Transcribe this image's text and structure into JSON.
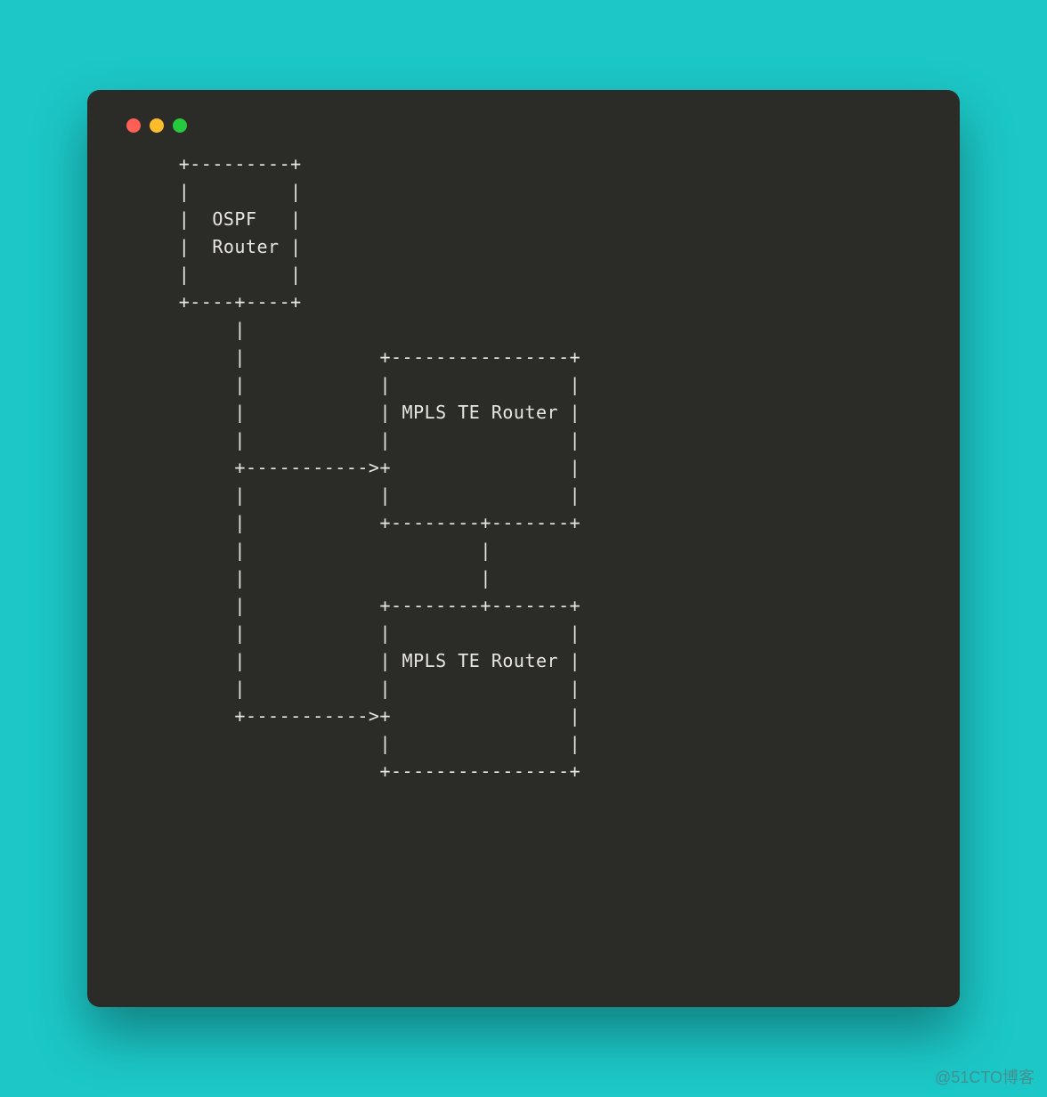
{
  "window": {
    "title_icons": [
      "close",
      "minimize",
      "maximize"
    ]
  },
  "diagram": {
    "lines": [
      "     +---------+",
      "     |         |",
      "     |  OSPF   |",
      "     |  Router |",
      "     |         |",
      "     +----+----+",
      "          |",
      "          |            +----------------+",
      "          |            |                |",
      "          |            | MPLS TE Router |",
      "          |            |                |",
      "          +----------->+                |",
      "          |            |                |",
      "          |            +--------+-------+",
      "          |                     |",
      "          |                     |",
      "          |            +--------+-------+",
      "          |            |                |",
      "          |            | MPLS TE Router |",
      "          |            |                |",
      "          +----------->+                |",
      "                       |                |",
      "                       +----------------+"
    ],
    "nodes": [
      {
        "label": "OSPF Router",
        "role": "source"
      },
      {
        "label": "MPLS TE Router",
        "role": "target"
      },
      {
        "label": "MPLS TE Router",
        "role": "target"
      }
    ],
    "edges": [
      {
        "from": "OSPF Router",
        "to": "MPLS TE Router (1)",
        "style": "dashed-arrow"
      },
      {
        "from": "OSPF Router",
        "to": "MPLS TE Router (2)",
        "style": "dashed-arrow"
      },
      {
        "from": "MPLS TE Router (1)",
        "to": "MPLS TE Router (2)",
        "style": "dashed-line"
      }
    ]
  },
  "watermark": "@51CTO博客"
}
